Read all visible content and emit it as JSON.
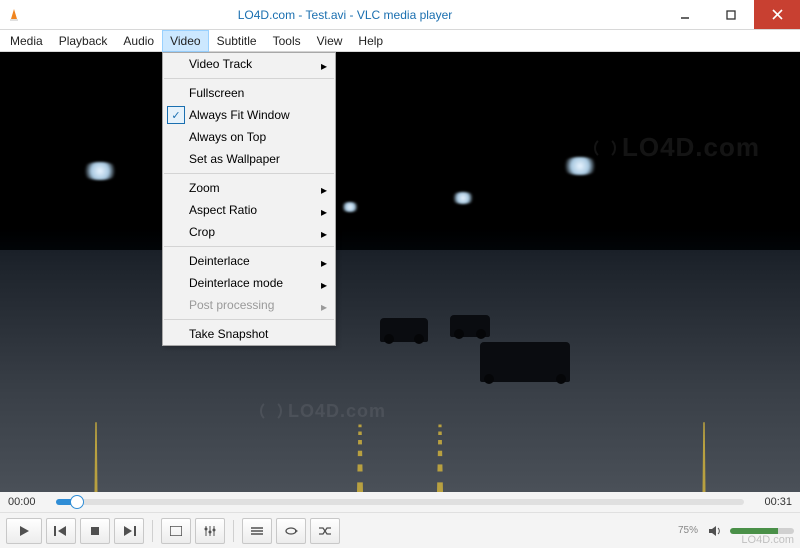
{
  "titlebar": {
    "title": "LO4D.com - Test.avi - VLC media player"
  },
  "menubar": {
    "items": [
      "Media",
      "Playback",
      "Audio",
      "Video",
      "Subtitle",
      "Tools",
      "View",
      "Help"
    ],
    "active_index": 3
  },
  "video_menu": {
    "groups": [
      [
        {
          "label": "Video Track",
          "submenu": true,
          "checked": false,
          "disabled": false
        }
      ],
      [
        {
          "label": "Fullscreen",
          "submenu": false,
          "checked": false,
          "disabled": false
        },
        {
          "label": "Always Fit Window",
          "submenu": false,
          "checked": true,
          "disabled": false
        },
        {
          "label": "Always on Top",
          "submenu": false,
          "checked": false,
          "disabled": false
        },
        {
          "label": "Set as Wallpaper",
          "submenu": false,
          "checked": false,
          "disabled": false
        }
      ],
      [
        {
          "label": "Zoom",
          "submenu": true,
          "checked": false,
          "disabled": false
        },
        {
          "label": "Aspect Ratio",
          "submenu": true,
          "checked": false,
          "disabled": false
        },
        {
          "label": "Crop",
          "submenu": true,
          "checked": false,
          "disabled": false
        }
      ],
      [
        {
          "label": "Deinterlace",
          "submenu": true,
          "checked": false,
          "disabled": false
        },
        {
          "label": "Deinterlace mode",
          "submenu": true,
          "checked": false,
          "disabled": false
        },
        {
          "label": "Post processing",
          "submenu": true,
          "checked": false,
          "disabled": true
        }
      ],
      [
        {
          "label": "Take Snapshot",
          "submenu": false,
          "checked": false,
          "disabled": false
        }
      ]
    ]
  },
  "seek": {
    "current": "00:00",
    "total": "00:31"
  },
  "controls": {
    "volume_pct": "75%"
  },
  "watermark": {
    "text": "LO4D.com"
  }
}
